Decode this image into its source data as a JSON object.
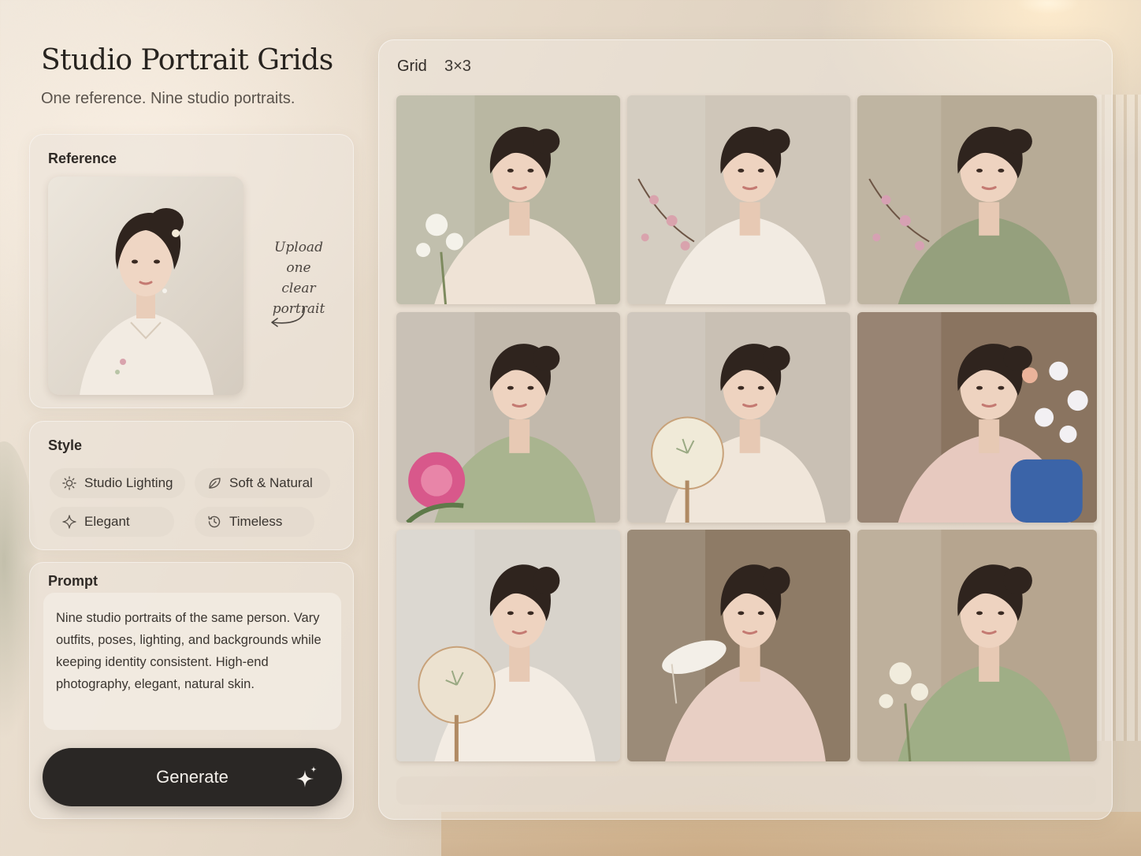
{
  "app": {
    "title": "Studio Portrait Grids",
    "subtitle": "One reference. Nine studio portraits."
  },
  "reference": {
    "label": "Reference",
    "upload_hint": "Upload one clear portrait"
  },
  "style": {
    "label": "Style",
    "options": [
      {
        "label": "Studio Lighting",
        "icon": "sun-icon"
      },
      {
        "label": "Soft & Natural",
        "icon": "leaf-icon"
      },
      {
        "label": "Elegant",
        "icon": "sparkle-icon"
      },
      {
        "label": "Timeless",
        "icon": "clock-history-icon"
      }
    ]
  },
  "prompt": {
    "label": "Prompt",
    "text": "Nine studio portraits of the same person. Vary outfits, poses, lighting, and backgrounds while keeping identity consistent. High-end photography, elegant, natural skin."
  },
  "generate": {
    "label": "Generate",
    "icon": "sparkle-icon"
  },
  "grid": {
    "label": "Grid",
    "size": "3×3",
    "tiles": [
      {
        "bg": "#b9b7a2",
        "outfit": "#efe3d6",
        "accent": "#f4f2ea",
        "prop": "flowers"
      },
      {
        "bg": "#cfc6b9",
        "outfit": "#f2ebe2",
        "accent": "#d9a3ad",
        "prop": "blossom"
      },
      {
        "bg": "#b7ab96",
        "outfit": "#95a07d",
        "accent": "#d6a1b3",
        "prop": "blossom"
      },
      {
        "bg": "#c2b9ac",
        "outfit": "#a9b48f",
        "accent": "#d8588b",
        "prop": "peony"
      },
      {
        "bg": "#c9c0b4",
        "outfit": "#f0e6da",
        "accent": "#f0ead8",
        "prop": "fan"
      },
      {
        "bg": "#8a7460",
        "outfit": "#e7c9bf",
        "accent": "#f2f0f3",
        "prop": "orchid"
      },
      {
        "bg": "#d8d3cb",
        "outfit": "#f3ece3",
        "accent": "#ece2d0",
        "prop": "fan"
      },
      {
        "bg": "#8e7b66",
        "outfit": "#e8cfc4",
        "accent": "#f3efe8",
        "prop": "feather"
      },
      {
        "bg": "#b6a58f",
        "outfit": "#9fae86",
        "accent": "#f1ecdd",
        "prop": "flowers"
      }
    ]
  },
  "colors": {
    "button_bg": "#2a2725",
    "button_text": "#f5f1ec",
    "panel_bg": "#ece4da"
  }
}
